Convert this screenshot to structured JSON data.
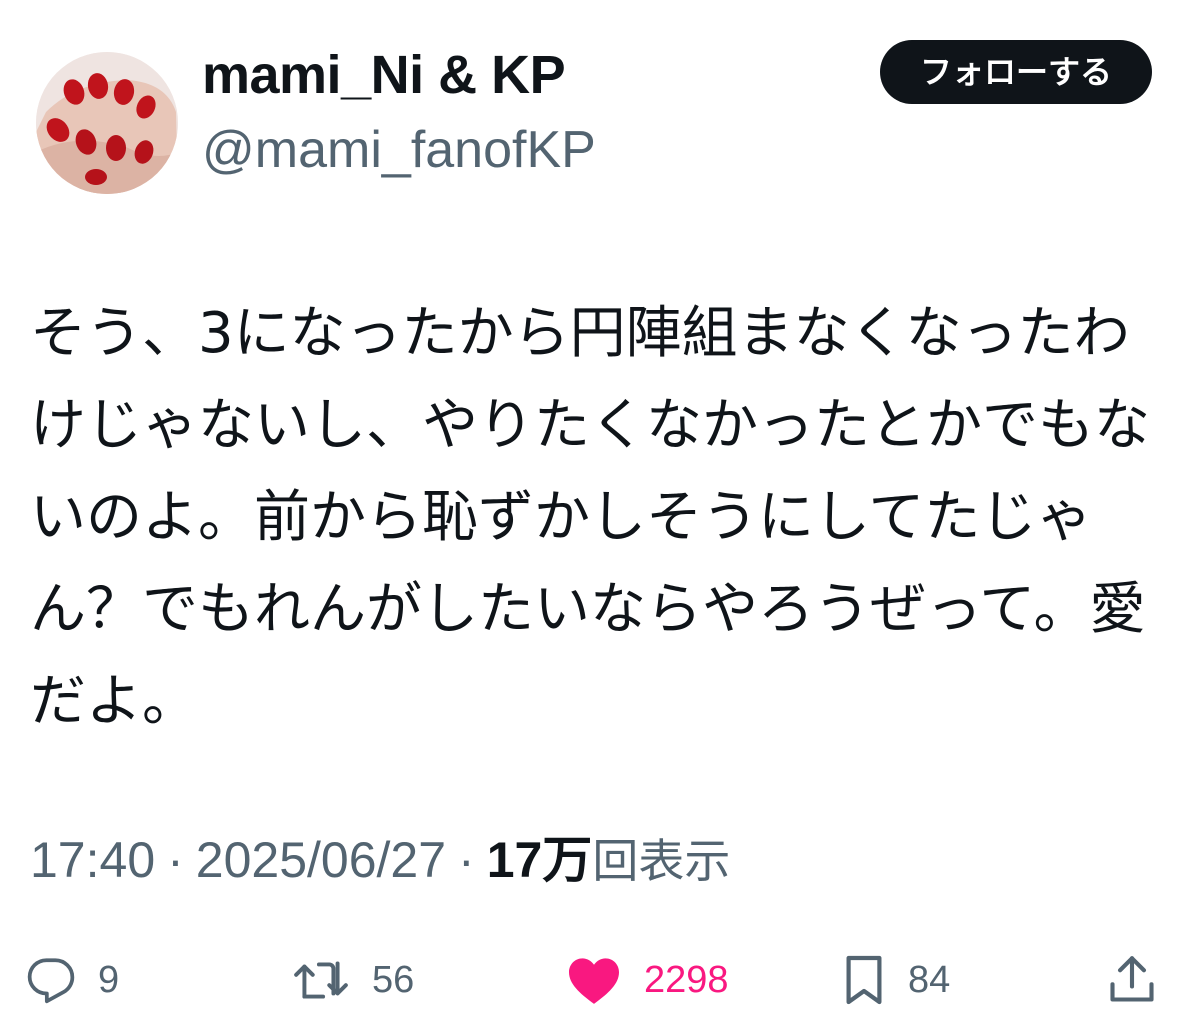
{
  "author": {
    "display_name": "mami_Ni & KP",
    "handle": "@mami_fanofKP",
    "avatar_icon": "avatar-red-nails"
  },
  "follow_button": {
    "label": "フォローする"
  },
  "tweet": {
    "text": "そう、3になったから円陣組まなくなったわけじゃないし、やりたくなかったとかでもないのよ。前から恥ずかしそうにしてたじゃん？でもれんがしたいならやろうぜって。愛だよ。"
  },
  "meta": {
    "time": "17:40",
    "separator": "·",
    "date": "2025/06/27",
    "views_count": "17万",
    "views_label": "回表示"
  },
  "actions": {
    "reply": {
      "icon": "reply-icon",
      "count": "9"
    },
    "retweet": {
      "icon": "retweet-icon",
      "count": "56"
    },
    "like": {
      "icon": "heart-icon",
      "count": "2298",
      "active": true
    },
    "bookmark": {
      "icon": "bookmark-icon",
      "count": "84"
    },
    "share": {
      "icon": "share-icon"
    }
  },
  "colors": {
    "text_primary": "#0f1419",
    "text_secondary": "#536471",
    "like_active": "#f91880",
    "follow_bg": "#0f1419",
    "follow_text": "#ffffff",
    "background": "#ffffff"
  }
}
